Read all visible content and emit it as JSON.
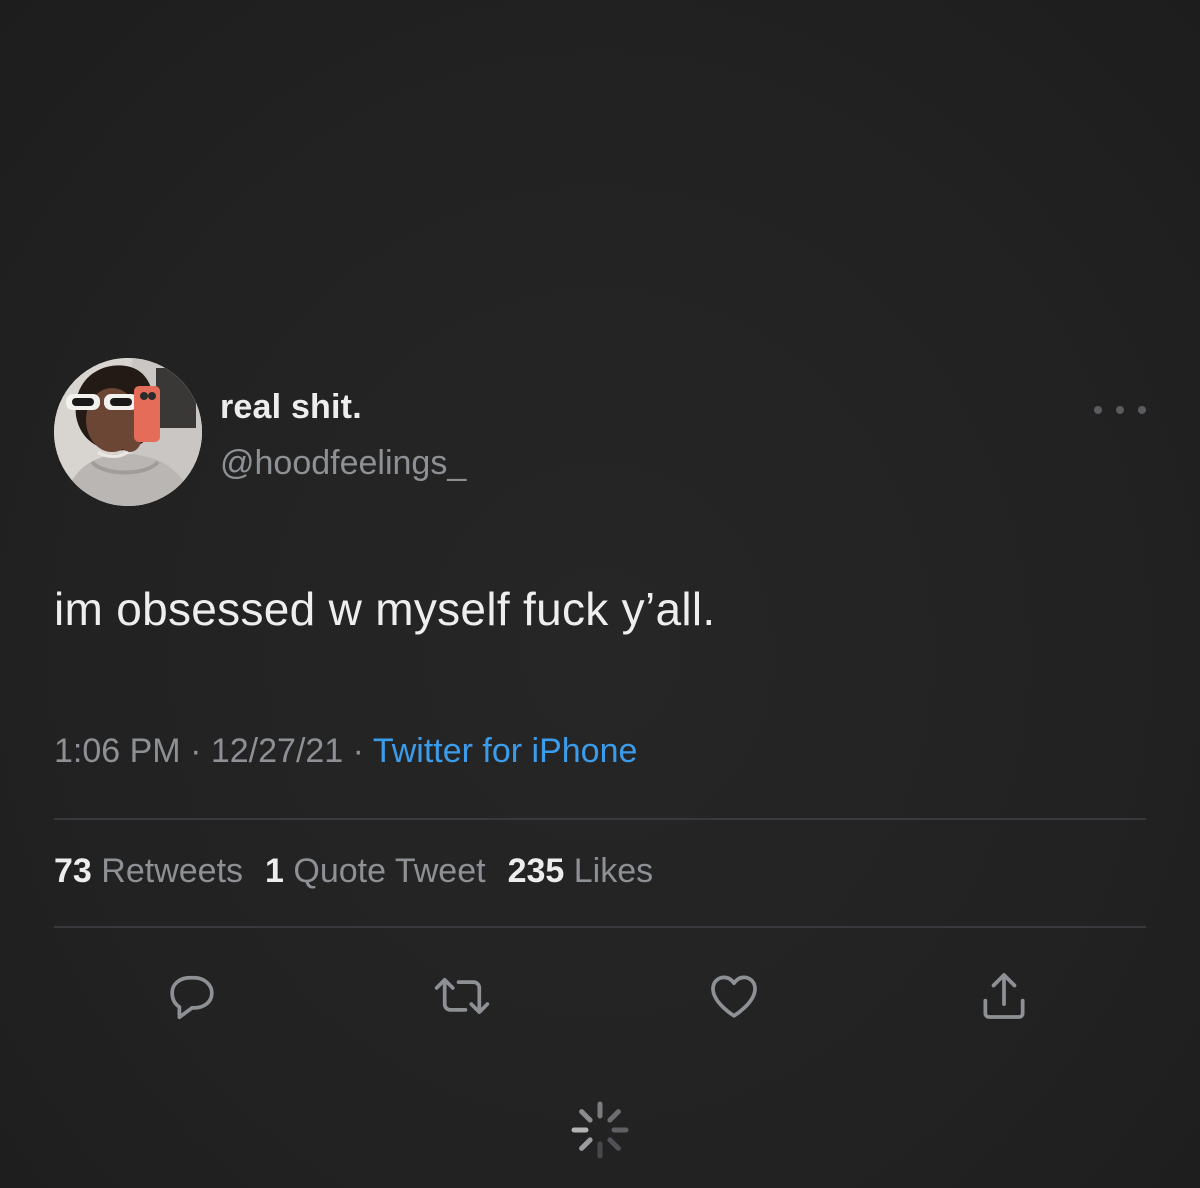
{
  "tweet": {
    "author": {
      "display_name": "real shit.",
      "handle": "@hoodfeelings_"
    },
    "text": "im obsessed w myself fuck y’all.",
    "meta": {
      "time": "1:06 PM",
      "date": "12/27/21",
      "separator": "·",
      "source": "Twitter for iPhone"
    },
    "stats": {
      "retweets_count": "73",
      "retweets_label": "Retweets",
      "quotes_count": "1",
      "quotes_label": "Quote Tweet",
      "likes_count": "235",
      "likes_label": "Likes"
    }
  },
  "actions": [
    {
      "name": "reply",
      "icon": "reply-icon"
    },
    {
      "name": "retweet",
      "icon": "retweet-icon"
    },
    {
      "name": "like",
      "icon": "heart-icon"
    },
    {
      "name": "share",
      "icon": "share-icon"
    }
  ],
  "colors": {
    "background": "#232323",
    "primary_text": "#eeeeee",
    "secondary_text": "#8d9094",
    "link": "#3b9cec",
    "icon": "#8d9094"
  }
}
